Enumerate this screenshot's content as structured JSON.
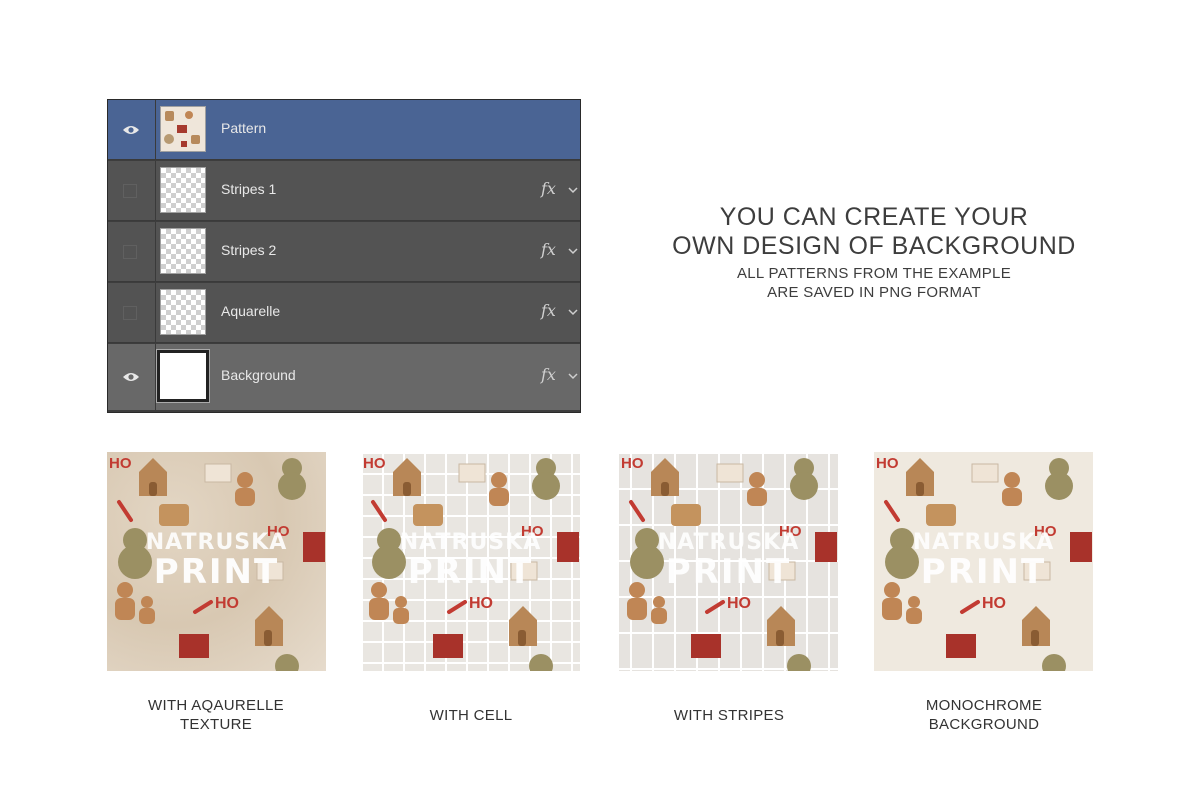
{
  "layers_panel": {
    "layers": [
      {
        "name": "Pattern",
        "visible": true,
        "has_fx": false,
        "thumbnail": "pattern",
        "selected": true
      },
      {
        "name": "Stripes 1",
        "visible": false,
        "has_fx": true,
        "thumbnail": "transparent",
        "selected": false
      },
      {
        "name": "Stripes 2",
        "visible": false,
        "has_fx": true,
        "thumbnail": "transparent",
        "selected": false
      },
      {
        "name": "Aquarelle",
        "visible": false,
        "has_fx": true,
        "thumbnail": "transparent",
        "selected": false
      },
      {
        "name": "Background",
        "visible": true,
        "has_fx": true,
        "thumbnail": "white",
        "selected": false
      }
    ],
    "fx_label": "fx",
    "colors": {
      "panel": "#535353",
      "selected": "#4a6494",
      "text": "#e8e8e8"
    }
  },
  "headline": {
    "line1": "YOU CAN CREATE YOUR",
    "line2": "OWN DESIGN OF BACKGROUND",
    "sub1": "ALL PATTERNS FROM THE EXAMPLE",
    "sub2": "ARE SAVED IN PNG FORMAT"
  },
  "watermark": {
    "line1": "NATRUSKA",
    "line2": "PRINT"
  },
  "motif_text": "HO",
  "samples": [
    {
      "caption1": "WITH AQAURELLE",
      "caption2": "TEXTURE"
    },
    {
      "caption1": "WITH CELL",
      "caption2": ""
    },
    {
      "caption1": "WITH STRIPES",
      "caption2": ""
    },
    {
      "caption1": "MONOCHROME",
      "caption2": "BACKGROUND"
    }
  ]
}
